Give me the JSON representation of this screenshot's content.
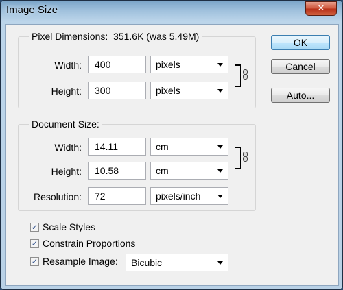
{
  "window": {
    "title": "Image Size"
  },
  "pixel_dimensions": {
    "legend": "Pixel Dimensions:",
    "summary": "351.6K (was 5.49M)",
    "width_label": "Width:",
    "width_value": "400",
    "width_unit": "pixels",
    "height_label": "Height:",
    "height_value": "300",
    "height_unit": "pixels"
  },
  "document_size": {
    "legend": "Document Size:",
    "width_label": "Width:",
    "width_value": "14.11",
    "width_unit": "cm",
    "height_label": "Height:",
    "height_value": "10.58",
    "height_unit": "cm",
    "resolution_label": "Resolution:",
    "resolution_value": "72",
    "resolution_unit": "pixels/inch"
  },
  "options": {
    "scale_styles": {
      "label": "Scale Styles",
      "checked": true
    },
    "constrain_proportions": {
      "label": "Constrain Proportions",
      "checked": true
    },
    "resample_image": {
      "label": "Resample Image:",
      "checked": true,
      "method": "Bicubic"
    }
  },
  "buttons": {
    "ok": "OK",
    "cancel": "Cancel",
    "auto": "Auto..."
  },
  "check_glyph": "✓",
  "close_glyph": "✕"
}
